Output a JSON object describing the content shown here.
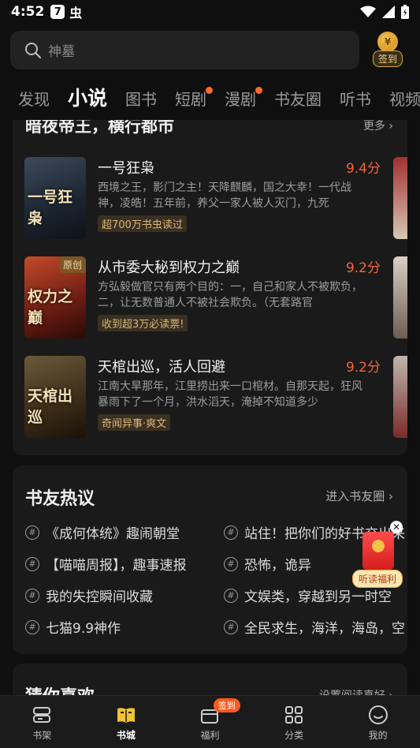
{
  "status_bar": {
    "time": "4:52",
    "app_badge": "7",
    "app_icon2": "虫"
  },
  "search": {
    "placeholder": "神墓"
  },
  "signin": {
    "label": "签到",
    "coin_glyph": "¥"
  },
  "tabs": [
    {
      "label": "发现",
      "active": false,
      "dot": false
    },
    {
      "label": "小说",
      "active": true,
      "dot": false
    },
    {
      "label": "图书",
      "active": false,
      "dot": false
    },
    {
      "label": "短剧",
      "active": false,
      "dot": true
    },
    {
      "label": "漫剧",
      "active": false,
      "dot": true
    },
    {
      "label": "书友圈",
      "active": false,
      "dot": false
    },
    {
      "label": "听书",
      "active": false,
      "dot": false
    },
    {
      "label": "视频",
      "active": false,
      "dot": false
    }
  ],
  "book_section": {
    "title": "暗夜帝王，横行都市",
    "more": "更多 ›",
    "books": [
      {
        "name": "一号狂枭",
        "score": "9.4分",
        "desc": "西境之王，影门之主！天降麒麟，国之大幸！一代战神，凌皓！五年前，养父一家人被人灭门，九死",
        "badge": "超700万书虫读过",
        "cover_text": "一号狂枭",
        "cover_tag": ""
      },
      {
        "name": "从市委大秘到权力之巅",
        "score": "9.2分",
        "desc": "方弘毅做官只有两个目的：一，自己和家人不被欺负，二，让无数普通人不被社会欺负。（无套路官",
        "badge": "收到超3万必读票!",
        "cover_text": "权力之巅",
        "cover_tag": "原创"
      },
      {
        "name": "天棺出巡，活人回避",
        "score": "9.2分",
        "desc": "江南大旱那年，江里捞出来一口棺材。自那天起，狂风暴雨下了一个月，洪水滔天，淹掉不知道多少",
        "badge": "奇闻异事·爽文",
        "cover_text": "天棺出巡",
        "cover_tag": ""
      }
    ]
  },
  "hot_discussion": {
    "title": "书友热议",
    "more": "进入书友圈 ›",
    "topics": [
      "《成何体统》趣闹朝堂",
      "站住！把你们的好书交出来",
      "【喵喵周报】，趣事速报",
      "恐怖，诡异",
      "我的失控瞬间收藏",
      "文娱类，穿越到另一时空",
      "七猫9.9神作",
      "全民求生，海洋，海岛，空"
    ]
  },
  "red_packet": {
    "label": "听读福利",
    "close": "✕"
  },
  "guess": {
    "title": "猜你喜欢",
    "more": "设置阅读喜好 ›"
  },
  "bottom_nav": [
    {
      "label": "书架",
      "icon": "bookshelf-icon",
      "active": false,
      "badge": ""
    },
    {
      "label": "书城",
      "icon": "bookstore-icon",
      "active": true,
      "badge": ""
    },
    {
      "label": "福利",
      "icon": "welfare-icon",
      "active": false,
      "badge": "签到"
    },
    {
      "label": "分类",
      "icon": "category-icon",
      "active": false,
      "badge": ""
    },
    {
      "label": "我的",
      "icon": "profile-icon",
      "active": false,
      "badge": ""
    }
  ],
  "colors": {
    "accent": "#e0b530",
    "score": "#f0643a",
    "background": "#0f0f0f",
    "card": "#1a1a1a"
  }
}
